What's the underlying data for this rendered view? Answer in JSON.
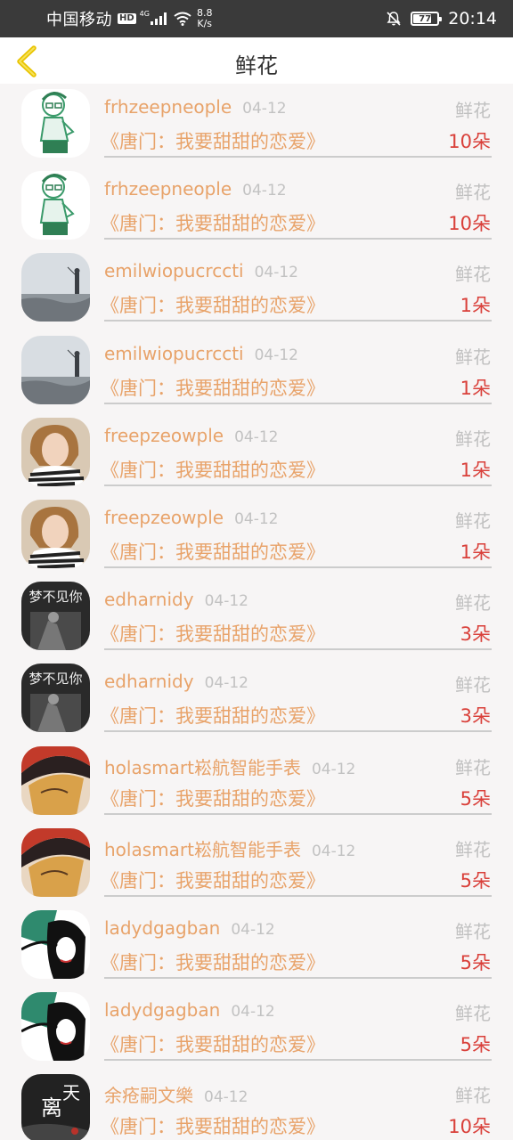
{
  "status_bar": {
    "carrier": "中国移动",
    "hd": "HD",
    "network": "4G",
    "speed_value": "8.8",
    "speed_unit": "K/s",
    "battery": "77",
    "time": "20:14"
  },
  "header": {
    "title": "鲜花",
    "back_icon": "chevron-left-icon"
  },
  "colors": {
    "accent": "#e8a36a",
    "count": "#d9403a",
    "muted": "#c0c0c0"
  },
  "records": [
    {
      "name": "frhzeepneople",
      "date": "04-12",
      "type": "鲜花",
      "book": "《唐门：我要甜甜的恋爱》",
      "count": "10朵",
      "avatar": "cartoon-boy-avatar"
    },
    {
      "name": "frhzeepneople",
      "date": "04-12",
      "type": "鲜花",
      "book": "《唐门：我要甜甜的恋爱》",
      "count": "10朵",
      "avatar": "cartoon-boy-avatar"
    },
    {
      "name": "emilwiopucrccti",
      "date": "04-12",
      "type": "鲜花",
      "book": "《唐门：我要甜甜的恋爱》",
      "count": "1朵",
      "avatar": "seaside-avatar"
    },
    {
      "name": "emilwiopucrccti",
      "date": "04-12",
      "type": "鲜花",
      "book": "《唐门：我要甜甜的恋爱》",
      "count": "1朵",
      "avatar": "seaside-avatar"
    },
    {
      "name": "freepzeowple",
      "date": "04-12",
      "type": "鲜花",
      "book": "《唐门：我要甜甜的恋爱》",
      "count": "1朵",
      "avatar": "girl-photo-avatar"
    },
    {
      "name": "freepzeowple",
      "date": "04-12",
      "type": "鲜花",
      "book": "《唐门：我要甜甜的恋爱》",
      "count": "1朵",
      "avatar": "girl-photo-avatar"
    },
    {
      "name": "edharnidy",
      "date": "04-12",
      "type": "鲜花",
      "book": "《唐门：我要甜甜的恋爱》",
      "count": "3朵",
      "avatar": "dark-text-avatar",
      "avatar_text": "梦不见你"
    },
    {
      "name": "edharnidy",
      "date": "04-12",
      "type": "鲜花",
      "book": "《唐门：我要甜甜的恋爱》",
      "count": "3朵",
      "avatar": "dark-text-avatar",
      "avatar_text": "梦不见你"
    },
    {
      "name": "holasmart崧航智能手表",
      "date": "04-12",
      "type": "鲜花",
      "book": "《唐门：我要甜甜的恋爱》",
      "count": "5朵",
      "avatar": "anime-hat-avatar"
    },
    {
      "name": "holasmart崧航智能手表",
      "date": "04-12",
      "type": "鲜花",
      "book": "《唐门：我要甜甜的恋爱》",
      "count": "5朵",
      "avatar": "anime-hat-avatar"
    },
    {
      "name": "ladydgagban",
      "date": "04-12",
      "type": "鲜花",
      "book": "《唐门：我要甜甜的恋爱》",
      "count": "5朵",
      "avatar": "manga-girl-avatar"
    },
    {
      "name": "ladydgagban",
      "date": "04-12",
      "type": "鲜花",
      "book": "《唐门：我要甜甜的恋爱》",
      "count": "5朵",
      "avatar": "manga-girl-avatar"
    },
    {
      "name": "余疮嗣文樂",
      "date": "04-12",
      "type": "鲜花",
      "book": "《唐门：我要甜甜的恋爱》",
      "count": "10朵",
      "avatar": "calligraphy-avatar",
      "avatar_text": "天涯离恨"
    }
  ]
}
